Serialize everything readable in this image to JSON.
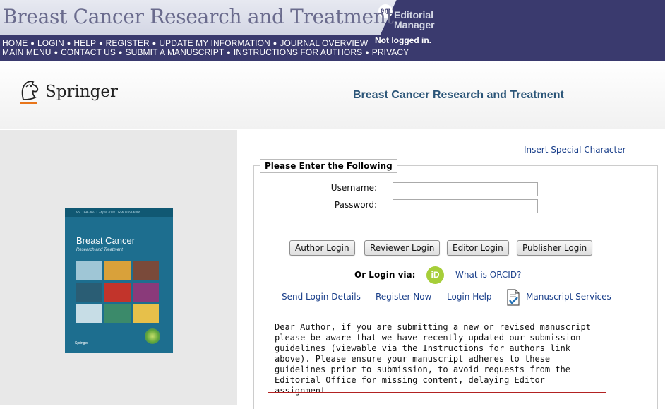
{
  "banner": {
    "title": "Breast Cancer Research and Treatment",
    "nav_row_1": [
      "HOME",
      "LOGIN",
      "HELP",
      "REGISTER",
      "UPDATE MY INFORMATION",
      "JOURNAL OVERVIEW"
    ],
    "nav_row_2": [
      "MAIN MENU",
      "CONTACT US",
      "SUBMIT A MANUSCRIPT",
      "INSTRUCTIONS FOR AUTHORS",
      "PRIVACY"
    ],
    "em_badge": "em",
    "em_brand_line1": "Editorial",
    "em_brand_line2": "Manager",
    "status": "Not logged in."
  },
  "publisher": {
    "name": "Springer",
    "journal_heading": "Breast Cancer Research and Treatment"
  },
  "cover": {
    "top_text": "Vol. 168 · No. 2 · April 2018 · ISSN 0167-6806",
    "title": "Breast Cancer",
    "subtitle": "Research and Treatment",
    "publisher": "Springer",
    "tile_colors": [
      "#9fc6d6",
      "#d9a13a",
      "#7a4a3a",
      "#2a5d74",
      "#c2342b",
      "#8a3a7a",
      "#c7dde6",
      "#3b8a6a",
      "#e7c04a"
    ]
  },
  "login": {
    "special_char_link": "Insert Special Character",
    "legend": "Please Enter the Following",
    "username_label": "Username:",
    "password_label": "Password:",
    "username_value": "",
    "password_value": "",
    "buttons": {
      "author": "Author Login",
      "reviewer": "Reviewer Login",
      "editor": "Editor Login",
      "publisher": "Publisher Login"
    },
    "or_login_via": "Or Login via:",
    "orcid_badge": "iD",
    "what_is_orcid": "What is ORCID?",
    "links": {
      "send_details": "Send Login Details",
      "register_now": "Register Now",
      "login_help": "Login Help",
      "manuscript_services": "Manuscript Services"
    },
    "notice": "Dear Author, if you are submitting a new or revised manuscript please be aware that we have recently updated our submission guidelines (viewable via the Instructions for authors link above). Please ensure your manuscript adheres to these guidelines prior to submission, to avoid requests from the Editorial Office for missing content, delaying Editor assignment."
  },
  "colors": {
    "banner_bg": "#3a3a6e",
    "link_blue": "#1a3f8a",
    "heading_blue": "#2b5578",
    "rule_red": "#b22222",
    "orcid_green": "#a6ce39"
  }
}
